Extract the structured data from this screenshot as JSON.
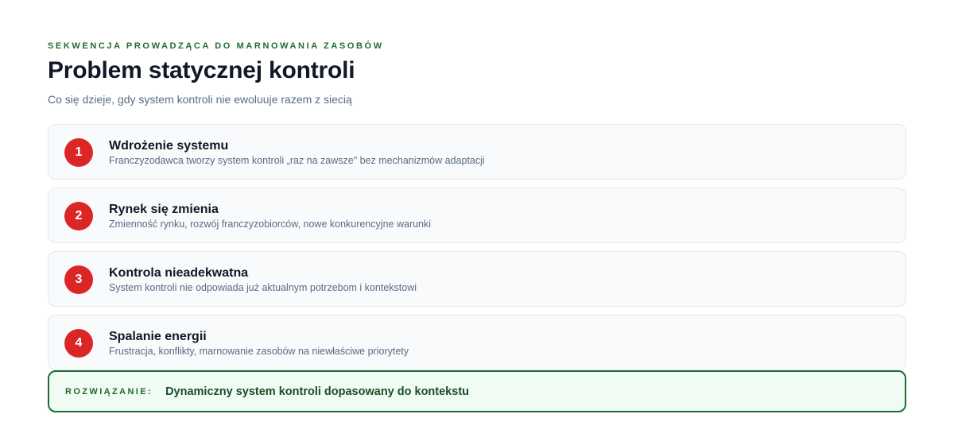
{
  "header": {
    "eyebrow": "SEKWENCJA PROWADZĄCA DO MARNOWANIA ZASOBÓW",
    "title": "Problem statycznej kontroli",
    "subtitle": "Co się dzieje, gdy system kontroli nie ewoluuje razem z siecią"
  },
  "steps": [
    {
      "number": "1",
      "title": "Wdrożenie systemu",
      "description": "Franczyzodawca tworzy system kontroli „raz na zawsze\" bez mechanizmów adaptacji"
    },
    {
      "number": "2",
      "title": "Rynek się zmienia",
      "description": "Zmienność rynku, rozwój franczyzobiorców, nowe konkurencyjne warunki"
    },
    {
      "number": "3",
      "title": "Kontrola nieadekwatna",
      "description": "System kontroli nie odpowiada już aktualnym potrzebom i kontekstowi"
    },
    {
      "number": "4",
      "title": "Spalanie energii",
      "description": "Frustracja, konflikty, marnowanie zasobów na niewłaściwe priorytety"
    }
  ],
  "solution": {
    "label": "ROZWIĄZANIE:",
    "text": "Dynamiczny system kontroli dopasowany do kontekstu"
  },
  "colors": {
    "accent_green": "#1f6b35",
    "badge_red": "#dc2626",
    "solution_bg": "#f0fbf3"
  }
}
